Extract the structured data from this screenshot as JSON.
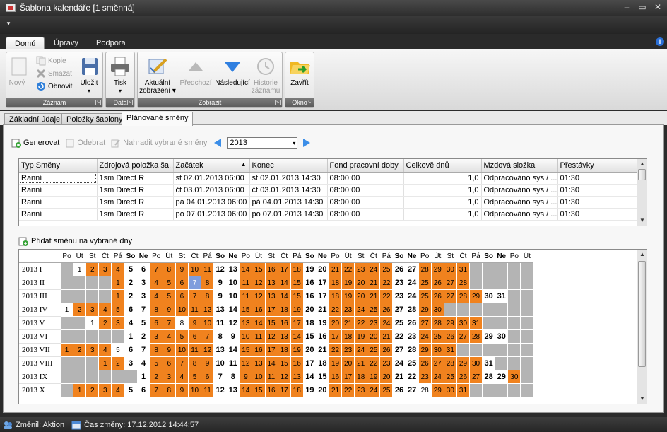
{
  "window": {
    "title": "Šablona kalendáře [1 směnná]"
  },
  "ribbon_tabs": [
    "Domů",
    "Úpravy",
    "Podpora"
  ],
  "ribbon": {
    "zaznam": {
      "caption": "Záznam",
      "novy": "Nový",
      "kopie": "Kopie",
      "smazat": "Smazat",
      "obnovit": "Obnovit",
      "ulozit": "Uložit"
    },
    "data": {
      "caption": "Data",
      "tisk": "Tisk"
    },
    "zobrazit": {
      "caption": "Zobrazit",
      "aktualni": "Aktuální",
      "zobrazeni": "zobrazení",
      "predchozi": "Předchozí",
      "nasledujici": "Následující",
      "historie": "Historie",
      "zaznamu": "záznamu"
    },
    "okno": {
      "caption": "Okno",
      "zavrit": "Zavřít"
    }
  },
  "main_tabs": [
    "Základní údaje",
    "Položky šablony",
    "Plánované směny"
  ],
  "toolbar": {
    "generovat": "Generovat",
    "odebrat": "Odebrat",
    "nahradit": "Nahradit vybrané směny",
    "year": "2013"
  },
  "grid": {
    "columns": [
      "Typ Směny",
      "Zdrojová položka ša...",
      "Začátek",
      "Konec",
      "Fond pracovní doby",
      "Celkově dnů",
      "Mzdová složka",
      "Přestávky"
    ],
    "rows": [
      [
        "Ranní",
        "1sm Direct R",
        "st 02.01.2013 06:00",
        "st 02.01.2013 14:30",
        "08:00:00",
        "1,0",
        "Odpracováno sys / ...",
        "01:30"
      ],
      [
        "Ranní",
        "1sm Direct R",
        "čt 03.01.2013 06:00",
        "čt 03.01.2013 14:30",
        "08:00:00",
        "1,0",
        "Odpracováno sys / ...",
        "01:30"
      ],
      [
        "Ranní",
        "1sm Direct R",
        "pá 04.01.2013 06:00",
        "pá 04.01.2013 14:30",
        "08:00:00",
        "1,0",
        "Odpracováno sys / ...",
        "01:30"
      ],
      [
        "Ranní",
        "1sm Direct R",
        "po 07.01.2013 06:00",
        "po 07.01.2013 14:30",
        "08:00:00",
        "1,0",
        "Odpracováno sys / ...",
        "01:30"
      ]
    ]
  },
  "add_shift_label": "Přidat směnu na vybrané dny",
  "calendar": {
    "day_headers": [
      "Po",
      "Út",
      "St",
      "Čt",
      "Pá",
      "So",
      "Ne",
      "Po",
      "Út",
      "St",
      "Čt",
      "Pá",
      "So",
      "Ne",
      "Po",
      "Út",
      "St",
      "Čt",
      "Pá",
      "So",
      "Ne",
      "Po",
      "Út",
      "St",
      "Čt",
      "Pá",
      "So",
      "Ne",
      "Po",
      "Út",
      "St",
      "Čt",
      "Pá",
      "So",
      "Ne",
      "Po",
      "Út"
    ],
    "months": [
      {
        "name": "2013 I",
        "offset": 1,
        "days": 31,
        "plain": [
          1
        ],
        "blue": []
      },
      {
        "name": "2013 II",
        "offset": 4,
        "days": 28,
        "plain": [],
        "blue": []
      },
      {
        "name": "2013 III",
        "offset": 4,
        "days": 31,
        "plain": [],
        "blue": []
      },
      {
        "name": "2013 IV",
        "offset": 0,
        "days": 30,
        "plain": [
          1
        ],
        "blue": []
      },
      {
        "name": "2013 V",
        "offset": 2,
        "days": 31,
        "plain": [
          1,
          8
        ],
        "blue": []
      },
      {
        "name": "2013 VI",
        "offset": 5,
        "days": 30,
        "plain": [],
        "blue": []
      },
      {
        "name": "2013 VII",
        "offset": 0,
        "days": 31,
        "plain": [
          5
        ],
        "blue": []
      },
      {
        "name": "2013 VIII",
        "offset": 3,
        "days": 31,
        "plain": [],
        "blue": []
      },
      {
        "name": "2013 IX",
        "offset": 6,
        "days": 30,
        "plain": [],
        "blue": []
      },
      {
        "name": "2013 X",
        "offset": 1,
        "days": 31,
        "plain": [
          28
        ],
        "blue": []
      }
    ],
    "selected": {
      "month": 1,
      "day": 7
    }
  },
  "status": {
    "changed_by": "Změnil: Aktion",
    "change_time": "Čas změny: 17.12.2012 14:44:57"
  }
}
